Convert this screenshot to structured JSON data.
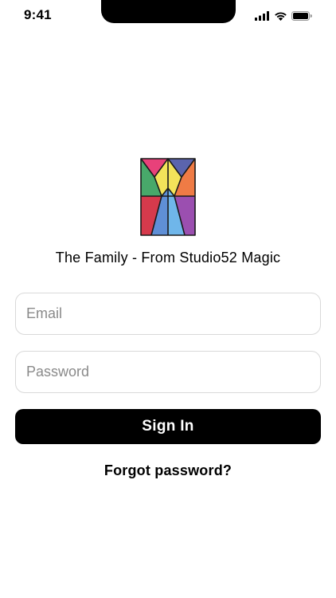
{
  "status_bar": {
    "time": "9:41",
    "icons": [
      "cellular-signal-icon",
      "wifi-icon",
      "battery-icon"
    ]
  },
  "logo": {
    "icon": "stained-glass-logo-icon",
    "colors": [
      "#e8417a",
      "#5f8fd6",
      "#48a86a",
      "#f3e35a",
      "#ef7b45",
      "#9b4fb0",
      "#6fb6ea",
      "#d63a4c",
      "#3a4a9c"
    ]
  },
  "app": {
    "title": "The Family - From Studio52 Magic"
  },
  "form": {
    "email": {
      "placeholder": "Email",
      "value": ""
    },
    "password": {
      "placeholder": "Password",
      "value": ""
    },
    "sign_in_label": "Sign In",
    "forgot_password_label": "Forgot password?"
  },
  "colors": {
    "primary_button": "#000000",
    "primary_button_text": "#ffffff",
    "field_border": "#d9d9d9",
    "placeholder": "#8a8a8a"
  }
}
